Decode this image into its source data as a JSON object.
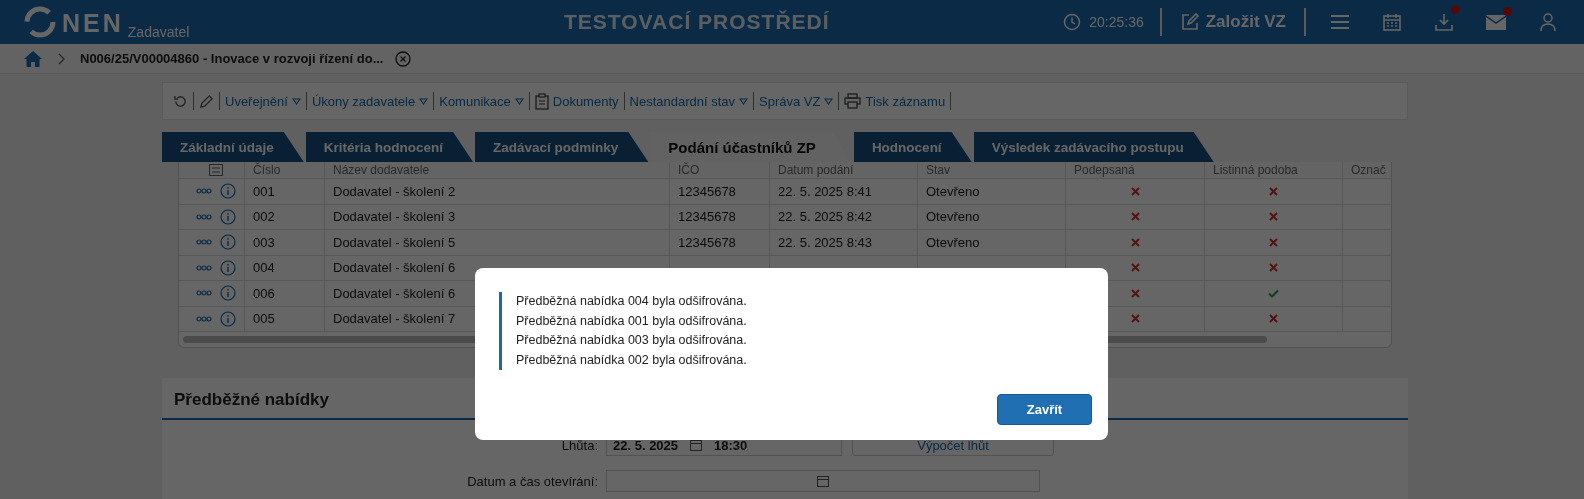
{
  "header": {
    "logo": "NEN",
    "subtitle": "Zadavatel",
    "environment": "TESTOVACÍ PROSTŘEDÍ",
    "time": "20:25:36",
    "create_button": "Založit VZ",
    "icons": [
      {
        "kind": "menu",
        "badge": false
      },
      {
        "kind": "calendar",
        "badge": false
      },
      {
        "kind": "download",
        "badge": true
      },
      {
        "kind": "mail",
        "badge": true
      },
      {
        "kind": "user",
        "badge": false
      }
    ]
  },
  "breadcrumb": {
    "title": "N006/25/V00004860 - Inovace v rozvoji řízení do..."
  },
  "toolbar": [
    {
      "kind": "refresh"
    },
    {
      "kind": "edit"
    },
    {
      "kind": "dropdown",
      "label": "Uveřejnění"
    },
    {
      "kind": "dropdown",
      "label": "Úkony zadavatele"
    },
    {
      "kind": "dropdown",
      "label": "Komunikace"
    },
    {
      "kind": "documents",
      "label": "Dokumenty"
    },
    {
      "kind": "dropdown",
      "label": "Nestandardní stav"
    },
    {
      "kind": "dropdown",
      "label": "Správa VZ"
    },
    {
      "kind": "print",
      "label": "Tisk záznamu"
    }
  ],
  "tabs": [
    {
      "label": "Základní údaje",
      "selected": false
    },
    {
      "label": "Kritéria hodnocení",
      "selected": false
    },
    {
      "label": "Zadávací podmínky",
      "selected": false
    },
    {
      "label": "Podání účastníků ZP",
      "selected": true
    },
    {
      "label": "Hodnocení",
      "selected": false
    },
    {
      "label": "Výsledek zadávacího postupu",
      "selected": false
    }
  ],
  "table": {
    "columns": [
      "Číslo",
      "Název dodavatele",
      "IČO",
      "Datum podání",
      "Stav",
      "Podepsaná",
      "Listinná podoba",
      "Označ"
    ],
    "rows": [
      {
        "number": "001",
        "supplier": "Dodavatel - školení 2",
        "ico": "12345678",
        "submitted": "22. 5. 2025 8:41",
        "status": "Otevřeno",
        "signed": false,
        "paper": false
      },
      {
        "number": "002",
        "supplier": "Dodavatel - školení 3",
        "ico": "12345678",
        "submitted": "22. 5. 2025 8:42",
        "status": "Otevřeno",
        "signed": false,
        "paper": false
      },
      {
        "number": "003",
        "supplier": "Dodavatel - školení 5",
        "ico": "12345678",
        "submitted": "22. 5. 2025 8:43",
        "status": "Otevřeno",
        "signed": false,
        "paper": false
      },
      {
        "number": "004",
        "supplier": "Dodavatel - školení 6",
        "signed": false,
        "paper": false
      },
      {
        "number": "006",
        "supplier": "Dodavatel - školení 6",
        "signed": false,
        "paper": true
      },
      {
        "number": "005",
        "supplier": "Dodavatel - školení 7",
        "signed": false,
        "paper": false
      }
    ]
  },
  "section": {
    "title": "Předběžné nabídky",
    "deadline_label": "Lhůta:",
    "deadline_date": "22. 5. 2025",
    "deadline_time": "18:30",
    "calc_button": "Výpočet lhůt",
    "opening_label": "Datum a čas otevírání:"
  },
  "dialog": {
    "messages": [
      "Předběžná nabídka 004 byla odšifrována.",
      "Předběžná nabídka 001 byla odšifrována.",
      "Předběžná nabídka 003 byla odšifrována.",
      "Předběžná nabídka 002 byla odšifrována."
    ],
    "close_button": "Zavřít"
  }
}
